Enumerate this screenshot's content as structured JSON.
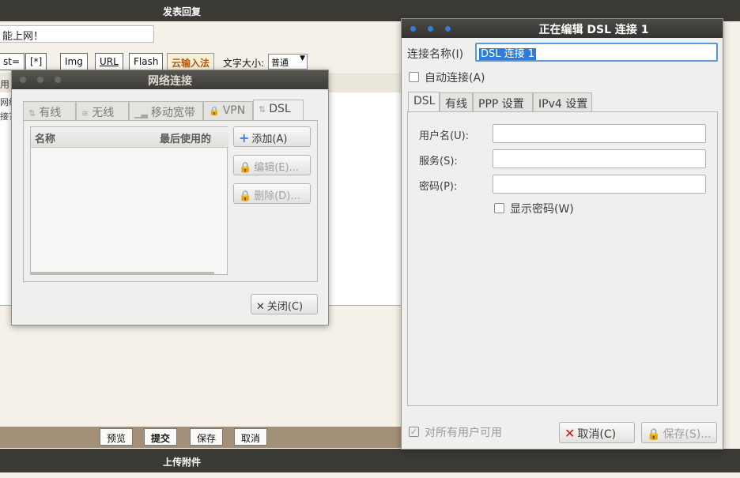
{
  "forum": {
    "top_title": "发表回复",
    "title_field_value": "能上网！",
    "toolbar": [
      {
        "label": "st=",
        "name": "toolbar-st-button"
      },
      {
        "label": "[*]",
        "name": "toolbar-list-button"
      },
      {
        "label": "Img",
        "name": "toolbar-img-button"
      },
      {
        "label": "URL",
        "name": "toolbar-url-button"
      },
      {
        "label": "Flash",
        "name": "toolbar-flash-button"
      },
      {
        "label": "云输入法",
        "name": "toolbar-cloud-ime-button"
      }
    ],
    "font_size_label": "文字大小:",
    "font_size_value": "普通",
    "stripe_text": "用",
    "body_text_1": "网络",
    "body_text_2": "接？",
    "actions": {
      "preview": "预览",
      "submit": "提交",
      "save": "保存",
      "cancel": "取消"
    },
    "bottom_title": "上传附件"
  },
  "network_window": {
    "title": "网络连接",
    "tabs": [
      "有线",
      "无线",
      "移动宽带",
      "VPN",
      "DSL"
    ],
    "active_tab": "DSL",
    "columns": [
      "名称",
      "最后使用的"
    ],
    "buttons": {
      "add": "添加(A)",
      "edit": "编辑(E)...",
      "delete": "删除(D)...",
      "close": "关闭(C)"
    }
  },
  "edit_window": {
    "title": "正在编辑 DSL 连接 1",
    "connection_name_label": "连接名称(I)",
    "connection_name_value": "DSL 连接 1",
    "auto_connect_label": "自动连接(A)",
    "tabs": [
      "DSL",
      "有线",
      "PPP 设置",
      "IPv4 设置"
    ],
    "active_tab": "DSL",
    "username_label": "用户名(U):",
    "username_value": "",
    "service_label": "服务(S):",
    "service_value": "",
    "password_label": "密码(P):",
    "password_value": "",
    "show_password_label": "显示密码(W)",
    "all_users_label": "对所有用户可用",
    "cancel_label": "取消(C)",
    "save_label": "保存(S)..."
  },
  "colors": {
    "accent": "#2f7ddb",
    "titlebar": "#3d3c38",
    "cancel_icon": "#d01010"
  }
}
